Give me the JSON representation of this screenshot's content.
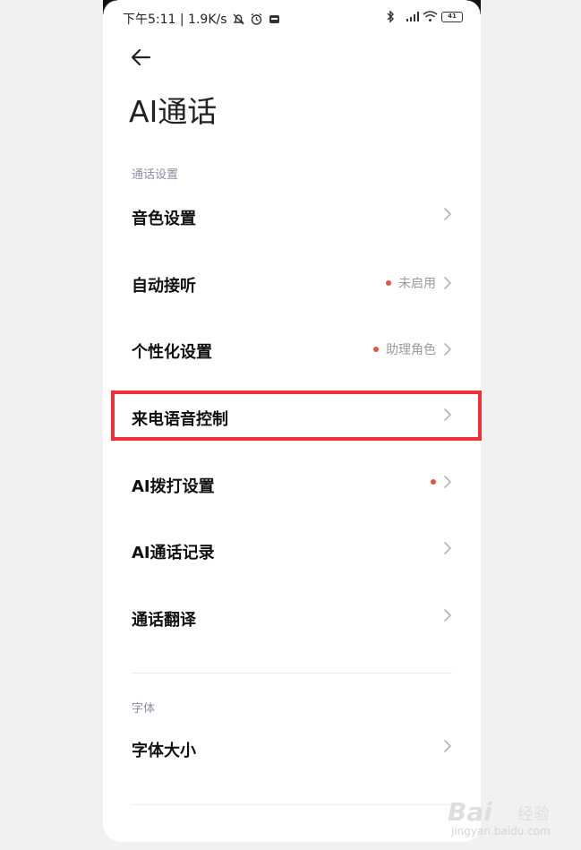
{
  "status": {
    "left": "下午5:11 | 1.9K/s",
    "battery": "41"
  },
  "header": {
    "title": "AI通话"
  },
  "sections": {
    "call": "通话设置",
    "font": "字体"
  },
  "rows": [
    {
      "label": "音色设置",
      "value": ""
    },
    {
      "label": "自动接听",
      "value": "未启用"
    },
    {
      "label": "个性化设置",
      "value": "助理角色"
    },
    {
      "label": "来电语音控制",
      "value": ""
    },
    {
      "label": "AI拨打设置",
      "value": ""
    },
    {
      "label": "AI通话记录",
      "value": ""
    },
    {
      "label": "通话翻译",
      "value": ""
    },
    {
      "label": "字体大小",
      "value": ""
    }
  ],
  "watermark": {
    "logo": "Bai",
    "text": "经验",
    "url": "jingyan.baidu.com"
  },
  "colors": {
    "highlight": "#ef3039",
    "dot": "#e9533d"
  },
  "icons": {
    "back": "back-arrow-icon",
    "chevron": "chevron-right-icon",
    "bluetooth": "bluetooth-icon",
    "signal": "signal-icon",
    "wifi": "wifi-icon",
    "battery": "battery-icon",
    "alarm": "alarm-icon",
    "notification": "notification-off-icon"
  }
}
